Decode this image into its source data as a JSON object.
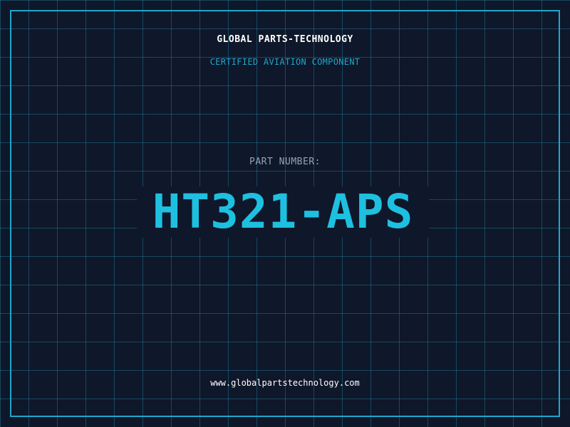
{
  "header": {
    "company_name": "GLOBAL PARTS-TECHNOLOGY",
    "certification": "CERTIFIED AVIATION COMPONENT"
  },
  "part": {
    "label": "PART NUMBER:",
    "number": "HT321-APS"
  },
  "footer": {
    "website": "www.globalpartstechnology.com"
  },
  "colors": {
    "background": "#0f172a",
    "accent": "#1ea7c9",
    "part_number": "#1ec0e0",
    "label": "#94a3b8",
    "text": "#ffffff"
  }
}
